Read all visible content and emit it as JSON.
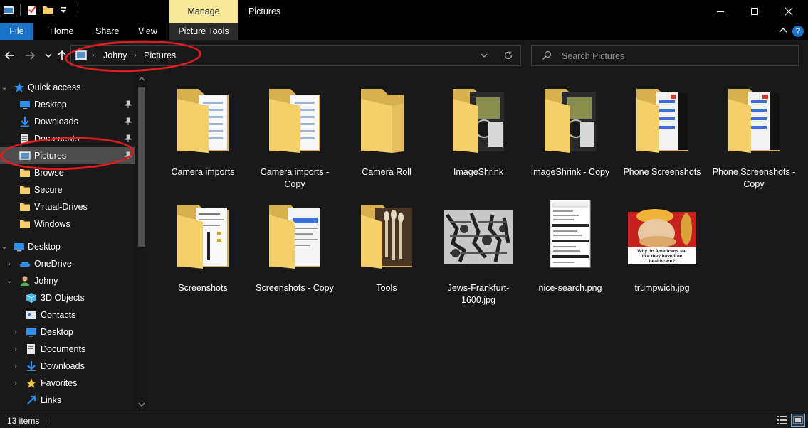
{
  "window": {
    "title": "Pictures",
    "context_tab": "Manage",
    "controls": {
      "minimize": "minimize-icon",
      "maximize": "maximize-icon",
      "close": "close-icon"
    }
  },
  "ribbon": {
    "tabs": [
      "File",
      "Home",
      "Share",
      "View",
      "Picture Tools"
    ]
  },
  "address": {
    "path": [
      "Johny",
      "Pictures"
    ],
    "search_placeholder": "Search Pictures"
  },
  "nav": {
    "quick_access": "Quick access",
    "quick_items": [
      {
        "label": "Desktop",
        "icon": "desktop-icon",
        "pinned": true
      },
      {
        "label": "Downloads",
        "icon": "downloads-icon",
        "pinned": true
      },
      {
        "label": "Documents",
        "icon": "documents-icon",
        "pinned": true
      },
      {
        "label": "Pictures",
        "icon": "pictures-icon",
        "pinned": true
      },
      {
        "label": "Browse",
        "icon": "folder-icon",
        "pinned": false
      },
      {
        "label": "Secure",
        "icon": "folder-icon",
        "pinned": false
      },
      {
        "label": "Virtual-Drives",
        "icon": "folder-icon",
        "pinned": false
      },
      {
        "label": "Windows",
        "icon": "folder-icon",
        "pinned": false
      }
    ],
    "desktop": "Desktop",
    "onedrive": "OneDrive",
    "user": "Johny",
    "user_items": [
      {
        "label": "3D Objects",
        "icon": "3d-objects-icon"
      },
      {
        "label": "Contacts",
        "icon": "contacts-icon"
      },
      {
        "label": "Desktop",
        "icon": "desktop-icon"
      },
      {
        "label": "Documents",
        "icon": "documents-icon"
      },
      {
        "label": "Downloads",
        "icon": "downloads-icon"
      },
      {
        "label": "Favorites",
        "icon": "star-icon"
      },
      {
        "label": "Links",
        "icon": "link-icon"
      }
    ]
  },
  "files": [
    {
      "name": "Camera imports",
      "kind": "folder-docs"
    },
    {
      "name": "Camera imports - Copy",
      "kind": "folder-docs"
    },
    {
      "name": "Camera Roll",
      "kind": "folder-empty"
    },
    {
      "name": "ImageShrink",
      "kind": "folder-photo"
    },
    {
      "name": "ImageShrink - Copy",
      "kind": "folder-photo"
    },
    {
      "name": "Phone Screenshots",
      "kind": "folder-phone"
    },
    {
      "name": "Phone Screenshots - Copy",
      "kind": "folder-phone"
    },
    {
      "name": "Screenshots",
      "kind": "folder-screens"
    },
    {
      "name": "Screenshots - Copy",
      "kind": "folder-screens2"
    },
    {
      "name": "Tools",
      "kind": "folder-tools"
    },
    {
      "name": "Jews-Frankfurt-1600.jpg",
      "kind": "image-engraving"
    },
    {
      "name": "nice-search.png",
      "kind": "image-phone"
    },
    {
      "name": "trumpwich.jpg",
      "kind": "image-news",
      "caption": "Why do Americans eat like they have free healthcare?"
    }
  ],
  "status": {
    "count": "13 items"
  },
  "colors": {
    "folder": "#f4cf6a",
    "accent": "#1a73c8",
    "manage_tab": "#f7e79b",
    "annotation": "#e11c1c"
  }
}
